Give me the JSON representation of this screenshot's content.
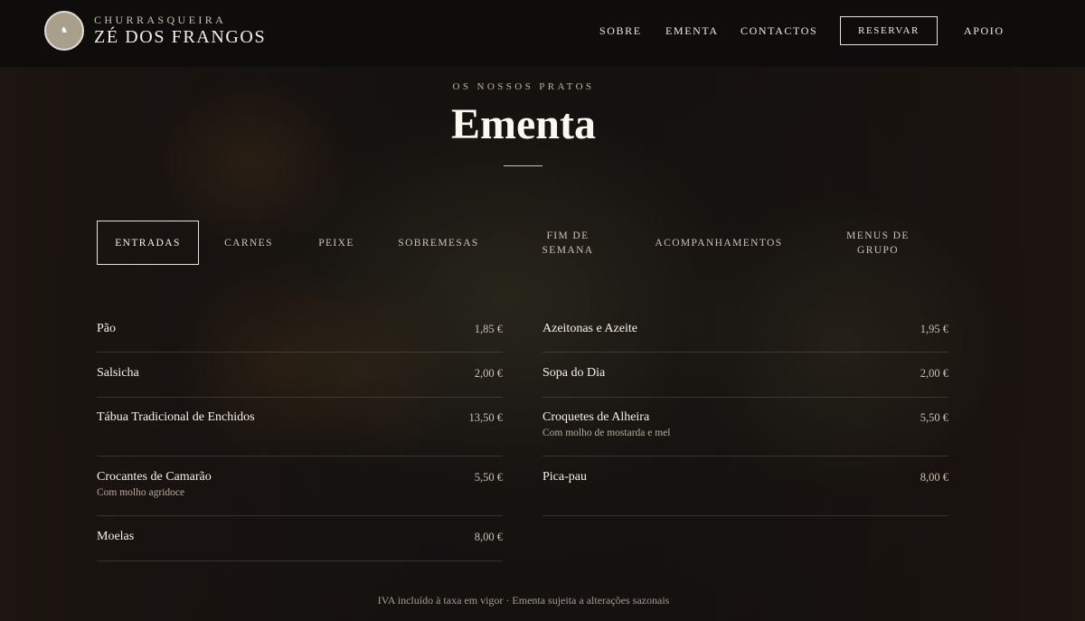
{
  "brand": {
    "small": "CHURRASQUEIRA",
    "main": "ZÉ DOS FRANGOS",
    "logo_icon": "rooster-logo-icon"
  },
  "nav": {
    "items": [
      "SOBRE",
      "EMENTA",
      "CONTACTOS"
    ],
    "reserve_label": "RESERVAR",
    "support_label": "APOIO"
  },
  "section": {
    "eyebrow": "OS NOSSOS PRATOS",
    "title": "Ementa"
  },
  "tabs": [
    {
      "label": "ENTRADAS",
      "active": true
    },
    {
      "label": "CARNES",
      "active": false
    },
    {
      "label": "PEIXE",
      "active": false
    },
    {
      "label": "SOBREMESAS",
      "active": false
    },
    {
      "label": "FIM DE\nSEMANA",
      "active": false
    },
    {
      "label": "ACOMPANHAMENTOS",
      "active": false
    },
    {
      "label": "MENUS DE\nGRUPO",
      "active": false
    }
  ],
  "menu": {
    "left": [
      {
        "name": "Pão",
        "price": "1,85 €",
        "desc": ""
      },
      {
        "name": "Salsicha",
        "price": "2,00 €",
        "desc": ""
      },
      {
        "name": "Tábua Tradicional de Enchidos",
        "price": "13,50 €",
        "desc": ""
      },
      {
        "name": "Crocantes de Camarão",
        "price": "5,50 €",
        "desc": "Com molho agridoce"
      },
      {
        "name": "Moelas",
        "price": "8,00 €",
        "desc": ""
      }
    ],
    "right": [
      {
        "name": "Azeitonas e Azeite",
        "price": "1,95 €",
        "desc": ""
      },
      {
        "name": "Sopa do Dia",
        "price": "2,00 €",
        "desc": ""
      },
      {
        "name": "Croquetes de Alheira",
        "price": "5,50 €",
        "desc": "Com molho de mostarda e mel"
      },
      {
        "name": "Pica-pau",
        "price": "8,00 €",
        "desc": ""
      }
    ]
  },
  "footnote": "IVA incluído à taxa em vigor · Ementa sujeita a alterações sazonais"
}
